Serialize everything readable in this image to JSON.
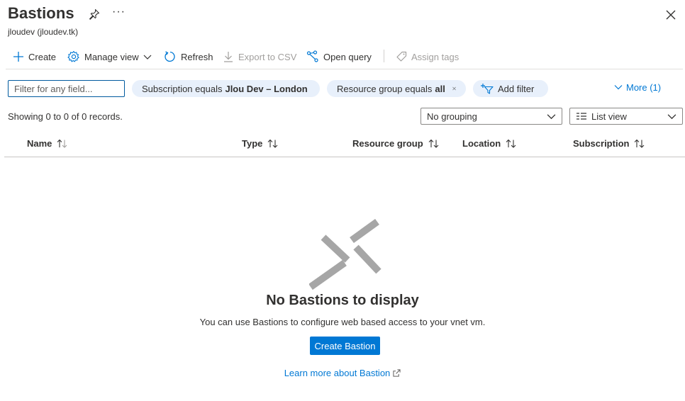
{
  "header": {
    "title": "Bastions",
    "subtitle": "jloudev (jloudev.tk)",
    "more_label": "···"
  },
  "toolbar": {
    "create": "Create",
    "manage_view": "Manage view",
    "refresh": "Refresh",
    "export_csv": "Export to CSV",
    "open_query": "Open query",
    "assign_tags": "Assign tags"
  },
  "filters": {
    "search_placeholder": "Filter for any field...",
    "subscription_prefix": "Subscription equals",
    "subscription_value": "Jlou Dev – London",
    "resource_group_prefix": "Resource group equals",
    "resource_group_value": "all",
    "add_filter": "Add filter",
    "more": "More (1)"
  },
  "records": {
    "summary": "Showing 0 to 0 of 0 records.",
    "grouping": "No grouping",
    "view": "List view"
  },
  "table": {
    "columns": [
      "Name",
      "Type",
      "Resource group",
      "Location",
      "Subscription"
    ]
  },
  "empty_state": {
    "title": "No Bastions to display",
    "description": "You can use Bastions to configure web based access to your vnet vm.",
    "create_button": "Create Bastion",
    "learn_more": "Learn more about Bastion"
  },
  "colors": {
    "accent": "#0078d4",
    "pill_bg": "#e8f0fb",
    "disabled": "#a19f9d",
    "empty_icon": "#a6a6a6"
  }
}
